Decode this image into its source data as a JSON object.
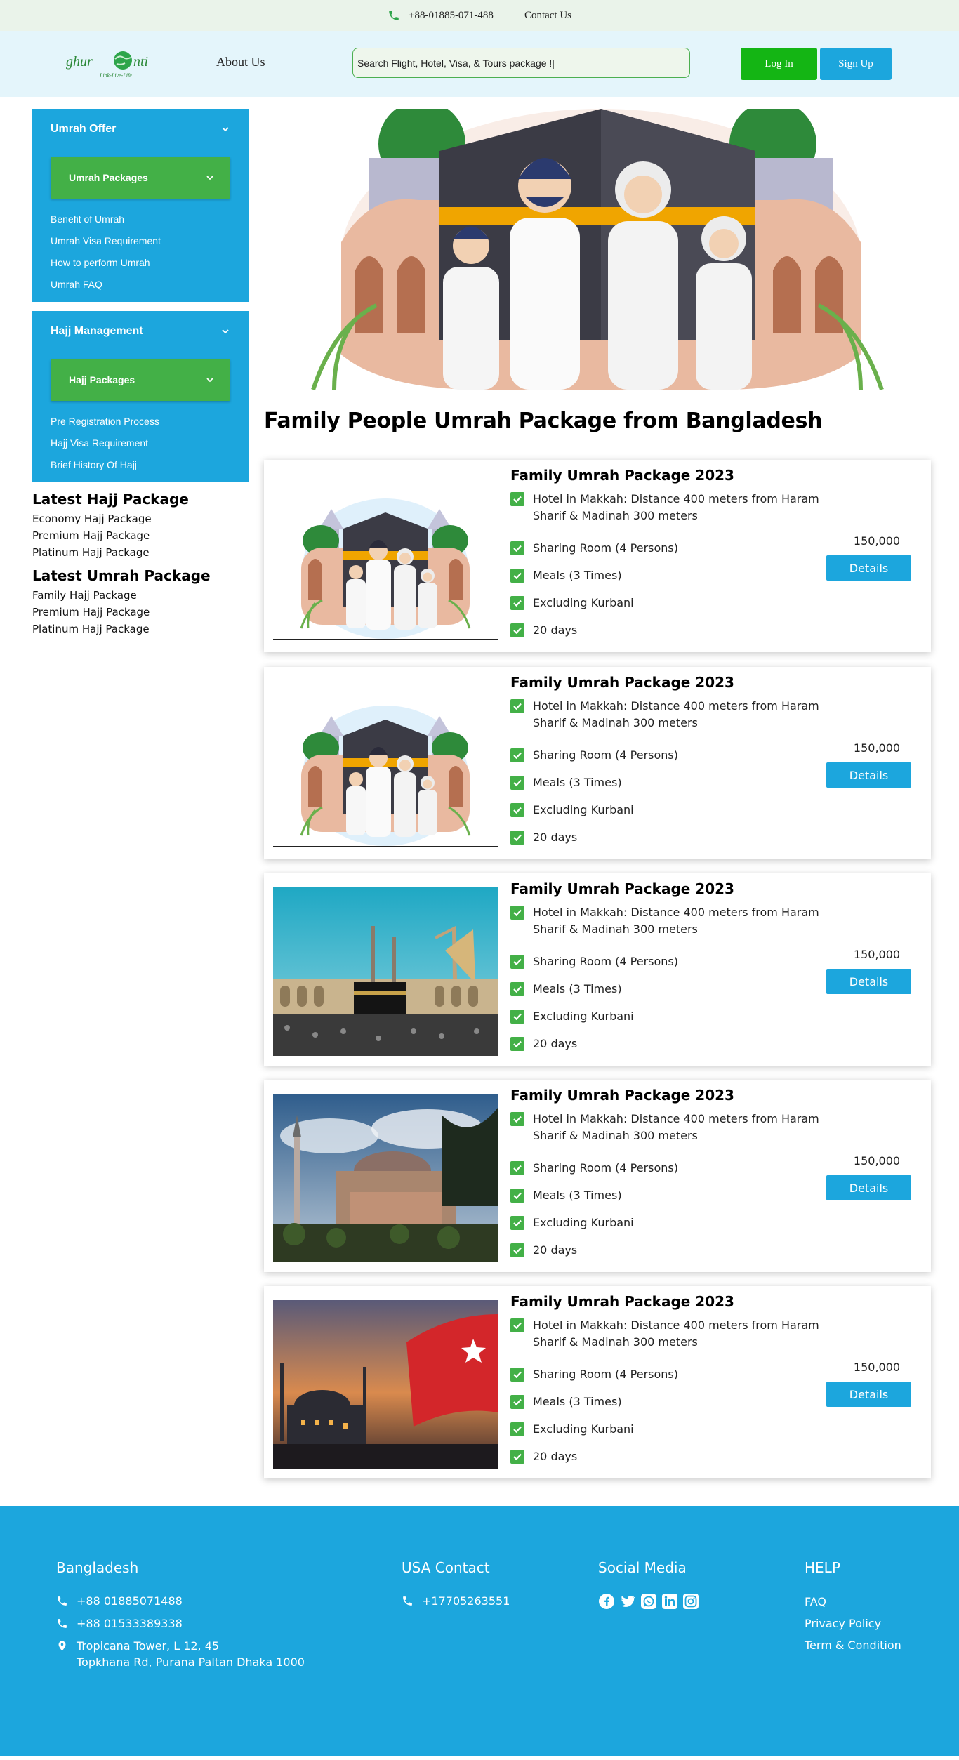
{
  "topbar": {
    "phone": "+88-01885-071-488",
    "contact": "Contact Us"
  },
  "header": {
    "logo_text": "ghurOnti",
    "logo_tagline": "Link-Live-Life",
    "about": "About Us",
    "search_value": "Search Flight, Hotel, Visa, & Tours package !|",
    "login": "Log In",
    "signup": "Sign Up"
  },
  "sidebar": {
    "umrah": {
      "title": "Umrah Offer",
      "packages": "Umrah Packages",
      "items": [
        "Benefit of Umrah",
        "Umrah Visa Requirement",
        "How to perform Umrah",
        "Umrah FAQ"
      ]
    },
    "hajj": {
      "title": "Hajj Management",
      "packages": "Hajj Packages",
      "items": [
        "Pre Registration Process",
        "Hajj Visa Requirement",
        "Brief History Of Hajj"
      ]
    },
    "latest_hajj": {
      "title": "Latest Hajj Package",
      "items": [
        "Economy Hajj Package",
        "Premium Hajj Package",
        "Platinum Hajj Package"
      ]
    },
    "latest_umrah": {
      "title": "Latest Umrah Package",
      "items": [
        "Family Hajj Package",
        "Premium Hajj Package",
        "Platinum Hajj Package"
      ]
    }
  },
  "main": {
    "title": "Family People Umrah Package from Bangladesh",
    "cards": [
      {
        "title": "Family Umrah Package 2023",
        "features": [
          "Hotel in Makkah: Distance 400 meters from Haram Sharif & Madinah 300 meters",
          "Sharing Room (4 Persons)",
          "Meals (3 Times)",
          "Excluding Kurbani",
          "20 days"
        ],
        "price": "150,000",
        "button": "Details",
        "image": "family-illustration"
      },
      {
        "title": "Family Umrah Package 2023",
        "features": [
          "Hotel in Makkah: Distance 400 meters from Haram Sharif & Madinah 300 meters",
          "Sharing Room (4 Persons)",
          "Meals (3 Times)",
          "Excluding Kurbani",
          "20 days"
        ],
        "price": "150,000",
        "button": "Details",
        "image": "family-illustration"
      },
      {
        "title": "Family Umrah Package 2023",
        "features": [
          "Hotel in Makkah: Distance 400 meters from Haram Sharif & Madinah 300 meters",
          "Sharing Room (4 Persons)",
          "Meals (3 Times)",
          "Excluding Kurbani",
          "20 days"
        ],
        "price": "150,000",
        "button": "Details",
        "image": "kaaba-photo"
      },
      {
        "title": "Family Umrah Package 2023",
        "features": [
          "Hotel in Makkah: Distance 400 meters from Haram Sharif & Madinah 300 meters",
          "Sharing Room (4 Persons)",
          "Meals (3 Times)",
          "Excluding Kurbani",
          "20 days"
        ],
        "price": "150,000",
        "button": "Details",
        "image": "mosque-photo"
      },
      {
        "title": "Family Umrah Package 2023",
        "features": [
          "Hotel in Makkah: Distance 400 meters from Haram Sharif & Madinah 300 meters",
          "Sharing Room (4 Persons)",
          "Meals (3 Times)",
          "Excluding Kurbani",
          "20 days"
        ],
        "price": "150,000",
        "button": "Details",
        "image": "sunset-mosque-photo"
      }
    ]
  },
  "footer": {
    "bangladesh": {
      "title": "Bangladesh",
      "phone1": "+88 01885071488",
      "phone2": "+88 01533389338",
      "address1": "Tropicana Tower, L 12, 45",
      "address2": "Topkhana Rd, Purana Paltan Dhaka 1000"
    },
    "usa": {
      "title": "USA Contact",
      "phone": "+17705263551"
    },
    "social": {
      "title": "Social Media",
      "icons": [
        "facebook-icon",
        "twitter-icon",
        "whatsapp-icon",
        "linkedin-icon",
        "instagram-icon"
      ]
    },
    "help": {
      "title": "HELP",
      "links": [
        "FAQ",
        "Privacy Policy",
        "Term & Condition"
      ]
    }
  },
  "colors": {
    "brand_blue": "#1ca6dd",
    "brand_green": "#43b047",
    "login_green": "#14b514"
  }
}
